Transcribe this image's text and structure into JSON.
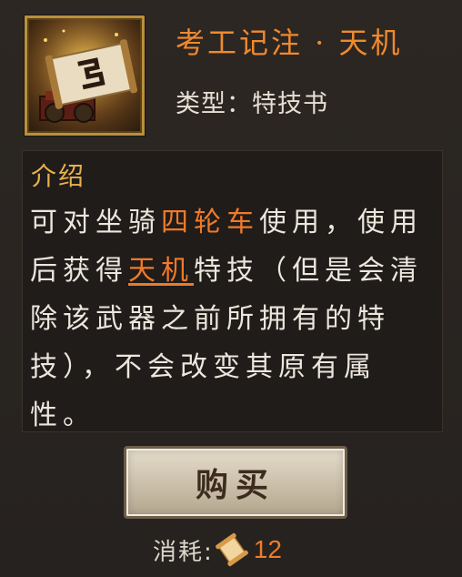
{
  "item": {
    "icon": "scroll-book-icon",
    "title": "考工记注 · 天机",
    "type_line": "类型：特技书"
  },
  "description": {
    "heading": "介绍",
    "seg1": "可对坐骑",
    "mount": "四轮车",
    "seg2": "使用，使用后获得",
    "skill": "天机",
    "seg3": "特技（但是会清除该武器之前所拥有的特技），不会改变其原有属性。"
  },
  "actions": {
    "buy_label": "购买"
  },
  "cost": {
    "label": "消耗:",
    "icon": "scroll-currency-icon",
    "value": "12"
  },
  "colors": {
    "title": "#f08a2d",
    "highlight": "#f07a2a",
    "heading": "#e8b04c",
    "frame_gold": "#b8913e"
  }
}
